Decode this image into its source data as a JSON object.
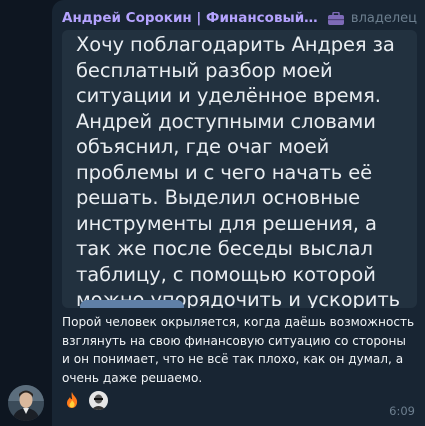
{
  "message": {
    "sender": "Андрей Сорокин | Финансовый консул...",
    "role": "владелец",
    "quote": "Хочу поблагодарить Андрея за бесплатный разбор моей ситуации и уделённое время. Андрей доступными словами объяснил, где очаг моей проблемы и с чего начать её решать. Выделил основные инструменты для решения, а так же после беседы выслал таблицу, с помощью которой можно упорядочить и ускорить погашение кредитов.",
    "text": "Порой человек окрыляется, когда даёшь возможность взглянуть на свою финансовую ситуацию со стороны и он понимает, что не всё так плохо, как он думал, а очень даже решаемо.",
    "time": "6:09",
    "reactions": [
      "fire-icon",
      "user-avatar"
    ]
  },
  "colors": {
    "background": "#0e1621",
    "bubble": "#182533",
    "sender_name": "#b5a3ff",
    "muted": "#6d7f8f"
  }
}
